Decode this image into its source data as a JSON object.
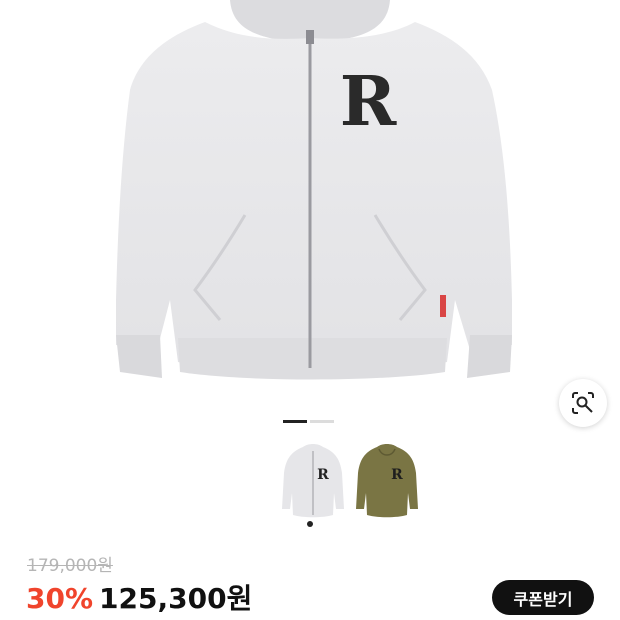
{
  "product": {
    "image_name": "gray-zip-hoodie",
    "logo_letter": "R",
    "colors": {
      "gray": "#e8e8ea",
      "olive": "#7a7544",
      "black": "#222222"
    }
  },
  "gallery": {
    "page_count": 2,
    "active_page": 1
  },
  "thumbnails": [
    {
      "color": "gray",
      "selected": true
    },
    {
      "color": "olive",
      "selected": false
    }
  ],
  "price": {
    "original": "179,000원",
    "discount": "30%",
    "final": "125,300원"
  },
  "coupon": {
    "label": "쿠폰받기"
  },
  "icons": {
    "lens": "image-search-icon"
  }
}
